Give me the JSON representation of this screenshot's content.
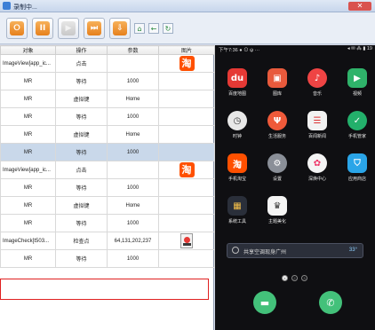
{
  "window": {
    "title": "录制中..."
  },
  "toolbar": {
    "buttons": [
      {
        "name": "record-button",
        "glyph": "⭘"
      },
      {
        "name": "pause-button",
        "glyph": "II"
      },
      {
        "name": "play-button",
        "glyph": "▶"
      },
      {
        "name": "step-button",
        "glyph": "⏭"
      },
      {
        "name": "export-button",
        "glyph": "⇩"
      }
    ],
    "nav": [
      "⌂",
      "←",
      "↻"
    ]
  },
  "table": {
    "headers": [
      "对象",
      "操作",
      "参数",
      "图片"
    ],
    "rows": [
      {
        "object": "ImageView[app_ic...",
        "action": "点击",
        "param": "",
        "image": "taobao"
      },
      {
        "object": "MR",
        "action": "等待",
        "param": "1000",
        "image": ""
      },
      {
        "object": "MR",
        "action": "虚拟键",
        "param": "Home",
        "image": ""
      },
      {
        "object": "MR",
        "action": "等待",
        "param": "1000",
        "image": ""
      },
      {
        "object": "MR",
        "action": "虚拟键",
        "param": "Home",
        "image": ""
      },
      {
        "object": "MR",
        "action": "等待",
        "param": "1000",
        "image": ""
      },
      {
        "object": "ImageView[app_ic...",
        "action": "点击",
        "param": "",
        "image": "taobao"
      },
      {
        "object": "MR",
        "action": "等待",
        "param": "1000",
        "image": ""
      },
      {
        "object": "MR",
        "action": "虚拟键",
        "param": "Home",
        "image": ""
      },
      {
        "object": "MR",
        "action": "等待",
        "param": "1000",
        "image": ""
      },
      {
        "object": "ImageCheck[t503...",
        "action": "检查点",
        "param": "64,131,202,237",
        "image": "pin"
      },
      {
        "object": "MR",
        "action": "等待",
        "param": "1000",
        "image": ""
      }
    ],
    "thumb_glyph": "淘"
  },
  "phone": {
    "status_left": "下午7:36 ● ⊙ ψ ···",
    "status_right": "◂ ✉ ⁂ ▮ 19",
    "apps": [
      {
        "label": "百度地图",
        "glyph": "du",
        "color": "#e53935"
      },
      {
        "label": "图库",
        "glyph": "▣",
        "color": "#e85a3c"
      },
      {
        "label": "音乐",
        "glyph": "♪",
        "color": "#ef4444"
      },
      {
        "label": "视频",
        "glyph": "▶",
        "color": "#2fb36a"
      },
      {
        "label": "时钟",
        "glyph": "◷",
        "color": "#e8e8e8"
      },
      {
        "label": "生活服务",
        "glyph": "Ψ",
        "color": "#ef5a3a"
      },
      {
        "label": "百闻新闻",
        "glyph": "☰",
        "color": "#f2f2f2"
      },
      {
        "label": "手机管家",
        "glyph": "✓",
        "color": "#23b06b"
      },
      {
        "label": "手机淘宝",
        "glyph": "淘",
        "color": "#ff5000"
      },
      {
        "label": "设置",
        "glyph": "⚙",
        "color": "#8a8f98"
      },
      {
        "label": "深焕中心",
        "glyph": "✿",
        "color": "#f4f4f4"
      },
      {
        "label": "应用商店",
        "glyph": "⛉",
        "color": "#2aa5e8"
      },
      {
        "label": "系统工具",
        "glyph": "▦",
        "color": "#2a2f3a"
      },
      {
        "label": "主题美化",
        "glyph": "♛",
        "color": "#f4f4f4"
      }
    ],
    "search": {
      "text": "共享空调现身广州",
      "weather": "33°"
    },
    "dots": [
      "●",
      "2",
      "3"
    ]
  }
}
